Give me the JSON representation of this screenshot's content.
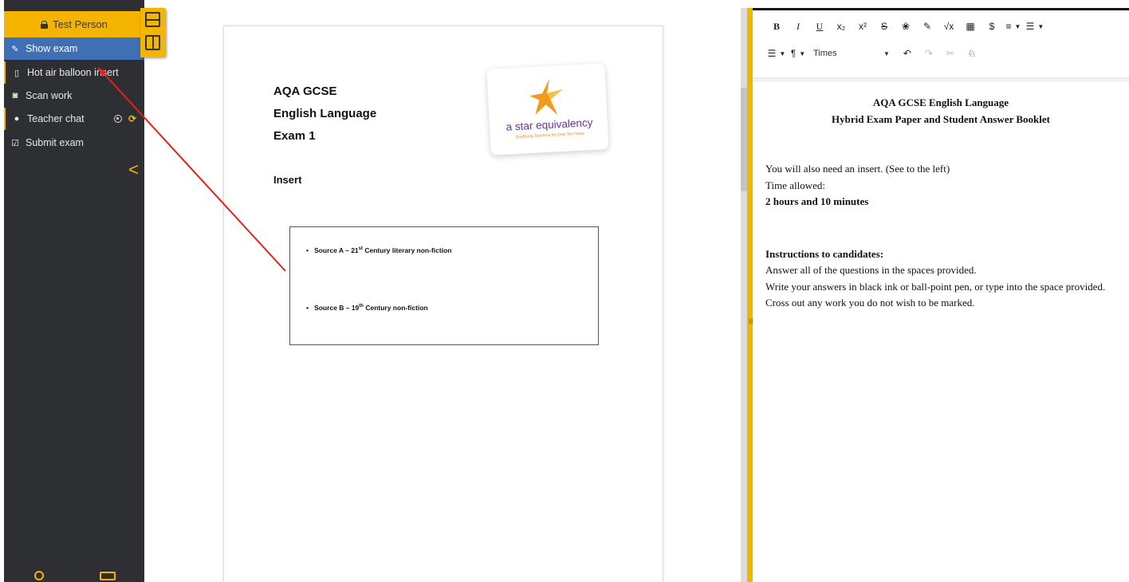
{
  "sidebar": {
    "user_name": "Test Person",
    "items": [
      {
        "label": "Show exam",
        "icon": "edit-icon"
      },
      {
        "label": "Hot air balloon insert",
        "icon": "map-icon"
      },
      {
        "label": "Scan work",
        "icon": "camera-icon"
      },
      {
        "label": "Teacher chat",
        "icon": "chat-icon"
      },
      {
        "label": "Submit exam",
        "icon": "check-square-icon"
      }
    ],
    "collapse_glyph": "<",
    "accent_color": "#f5b400",
    "active_color": "#3f6fb5"
  },
  "document": {
    "title_lines": [
      "AQA GCSE",
      "English Language",
      "Exam 1"
    ],
    "insert_heading": "Insert",
    "logo_text": "a star equivalency",
    "logo_tagline": "Qualifying Teachers for Over Ten Years",
    "sources": [
      {
        "prefix": "Source A – 21",
        "sup": "st",
        "suffix": " Century literary non-fiction"
      },
      {
        "prefix": "Source B – 19",
        "sup": "th",
        "suffix": " Century non-fiction"
      }
    ]
  },
  "editor": {
    "toolbar_row1": [
      "B",
      "I",
      "U",
      "x₂",
      "x²",
      "S",
      "💧",
      "🖌",
      "√x",
      "▦",
      "$",
      "≡",
      "☰"
    ],
    "toolbar_row2_font": "Times",
    "heading_line1": "AQA GCSE English Language",
    "heading_line2": "Hybrid Exam Paper and Student Answer Booklet",
    "insert_note": "You will also need an insert. (See to the left)",
    "time_label": "Time allowed:",
    "time_value": "2 hours and 10 minutes",
    "instructions_heading": "Instructions to candidates:",
    "instructions": [
      "Answer all of the questions in the spaces provided.",
      "Write your answers in black ink or ball-point pen, or type into the space provided.",
      "Cross out any work you do not wish to be marked."
    ]
  }
}
